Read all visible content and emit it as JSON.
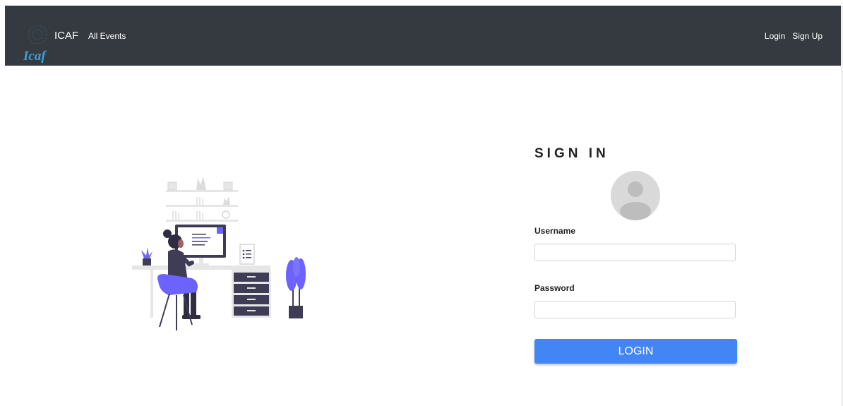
{
  "navbar": {
    "brand_name": "ICAF",
    "logo_script": "Icaf",
    "links": {
      "all_events": "All Events",
      "login": "Login",
      "sign_up": "Sign Up"
    }
  },
  "form": {
    "title": "SIGN IN",
    "username_label": "Username",
    "username_value": "",
    "password_label": "Password",
    "password_value": "",
    "login_button": "LOGIN"
  },
  "colors": {
    "navbar_bg": "#343a40",
    "primary_button": "#4285f4",
    "illustration_accent": "#6c63ff",
    "illustration_dark": "#3f3d56"
  },
  "icons": {
    "avatar": "user-avatar-icon",
    "logo": "icaf-logo-icon",
    "illustration": "woman-at-desk-illustration"
  }
}
